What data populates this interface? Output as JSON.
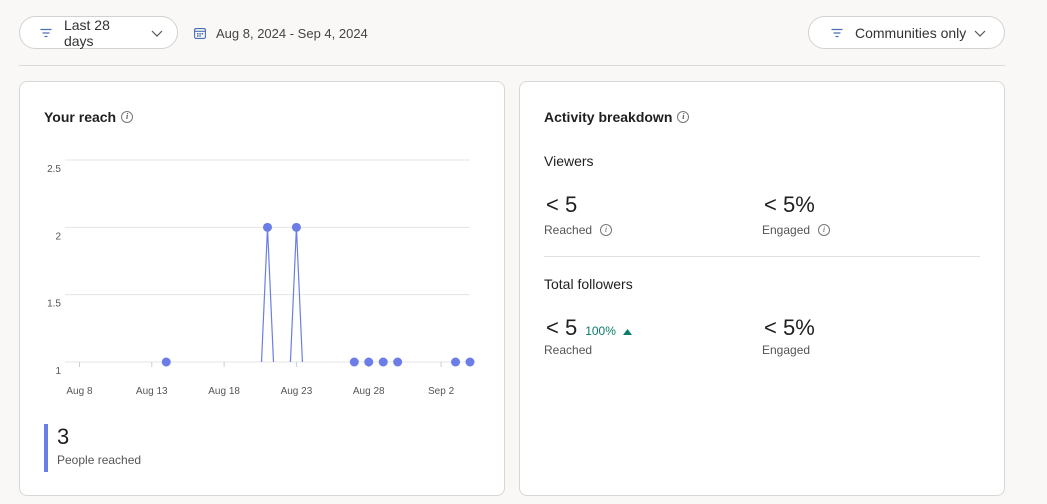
{
  "filters": {
    "range_label": "Last 28 days",
    "date_range": "Aug 8, 2024 - Sep 4, 2024",
    "community_label": "Communities only"
  },
  "reach": {
    "title": "Your reach",
    "summary_value": "3",
    "summary_label": "People reached"
  },
  "chart_data": {
    "type": "line",
    "title": "Your reach",
    "y_ticks": [
      "2.5",
      "2",
      "1.5",
      "1"
    ],
    "ylim": [
      1,
      2.5
    ],
    "x_tick_labels": [
      "Aug 8",
      "Aug 13",
      "Aug 18",
      "Aug 23",
      "Aug 28",
      "Sep 2"
    ],
    "x_tick_days": [
      8,
      13,
      18,
      23,
      28,
      33
    ],
    "xlim": [
      7,
      35
    ],
    "points": [
      {
        "day": 14,
        "value": 1
      },
      {
        "day": 21,
        "value": 2
      },
      {
        "day": 23,
        "value": 2
      },
      {
        "day": 27,
        "value": 1
      },
      {
        "day": 28,
        "value": 1
      },
      {
        "day": 29,
        "value": 1
      },
      {
        "day": 30,
        "value": 1
      },
      {
        "day": 34,
        "value": 1
      },
      {
        "day": 35,
        "value": 1
      }
    ],
    "grid": true,
    "color": "#6b7de6"
  },
  "activity": {
    "title": "Activity breakdown",
    "viewers_label": "Viewers",
    "viewers_reached_value": "< 5",
    "viewers_reached_label": "Reached",
    "viewers_engaged_value": "< 5%",
    "viewers_engaged_label": "Engaged",
    "followers_label": "Total followers",
    "followers_reached_value": "< 5",
    "followers_change": "100%",
    "followers_reached_label": "Reached",
    "followers_engaged_value": "< 5%",
    "followers_engaged_label": "Engaged"
  },
  "colors": {
    "accent": "#6b7de6",
    "positive": "#0a7d6a"
  }
}
